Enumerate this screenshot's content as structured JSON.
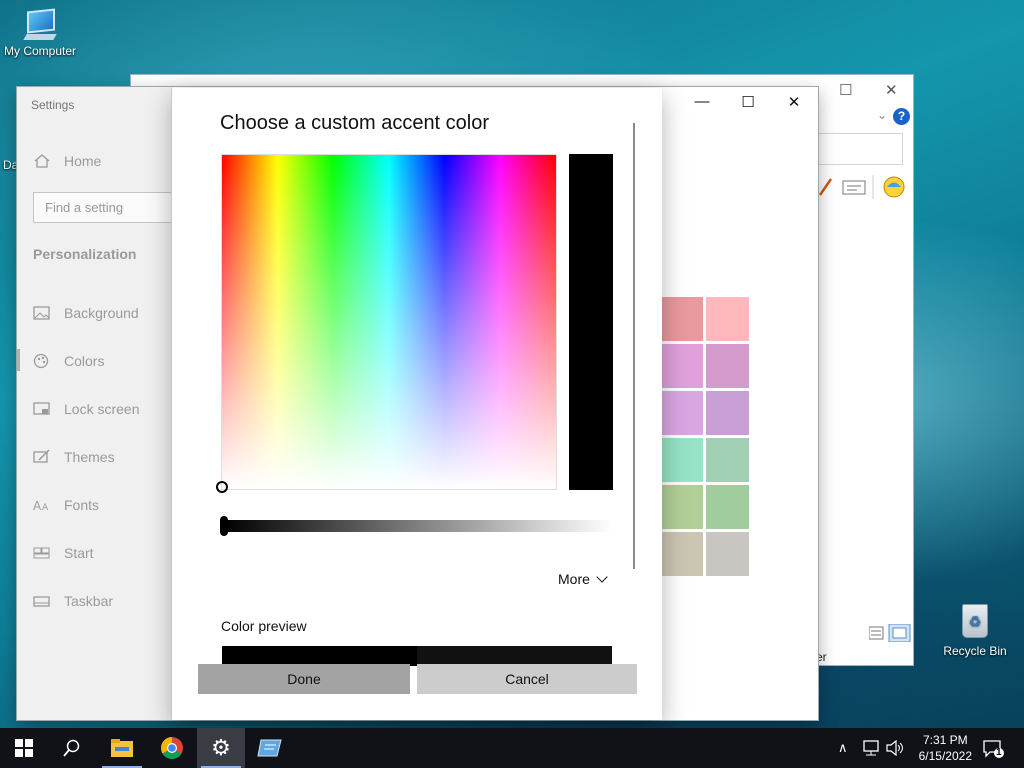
{
  "desktop": {
    "my_computer_label": "My Computer",
    "recycle_bin_label": "Recycle Bin",
    "partial_label": "Da"
  },
  "explorer": {
    "status_text": "uter"
  },
  "settings": {
    "app_title": "Settings",
    "home_label": "Home",
    "search_placeholder": "Find a setting",
    "section_title": "Personalization",
    "nav": [
      {
        "label": "Background",
        "icon": "image-icon"
      },
      {
        "label": "Colors",
        "icon": "palette-icon"
      },
      {
        "label": "Lock screen",
        "icon": "lock-screen-icon"
      },
      {
        "label": "Themes",
        "icon": "brush-icon"
      },
      {
        "label": "Fonts",
        "icon": "fonts-icon"
      },
      {
        "label": "Start",
        "icon": "start-icon"
      },
      {
        "label": "Taskbar",
        "icon": "taskbar-icon"
      }
    ],
    "accent_swatches": [
      "#e89a9e",
      "#ffb9bc",
      "#e0a0dc",
      "#d59bcd",
      "#d9a6e3",
      "#c8a0d6",
      "#96e3c5",
      "#a1cfb4",
      "#b3cf98",
      "#a1cc9e",
      "#cbc6b2",
      "#c9c6c1"
    ]
  },
  "dialog": {
    "title": "Choose a custom accent color",
    "more_label": "More",
    "preview_label": "Color preview",
    "selected_color": "#000000",
    "done_label": "Done",
    "cancel_label": "Cancel"
  },
  "taskbar": {
    "time": "7:31 PM",
    "date": "6/15/2022",
    "notification_count": "1",
    "pinned": [
      "start-icon",
      "search-icon",
      "file-explorer-icon",
      "chrome-icon",
      "settings-icon",
      "control-panel-icon"
    ]
  }
}
